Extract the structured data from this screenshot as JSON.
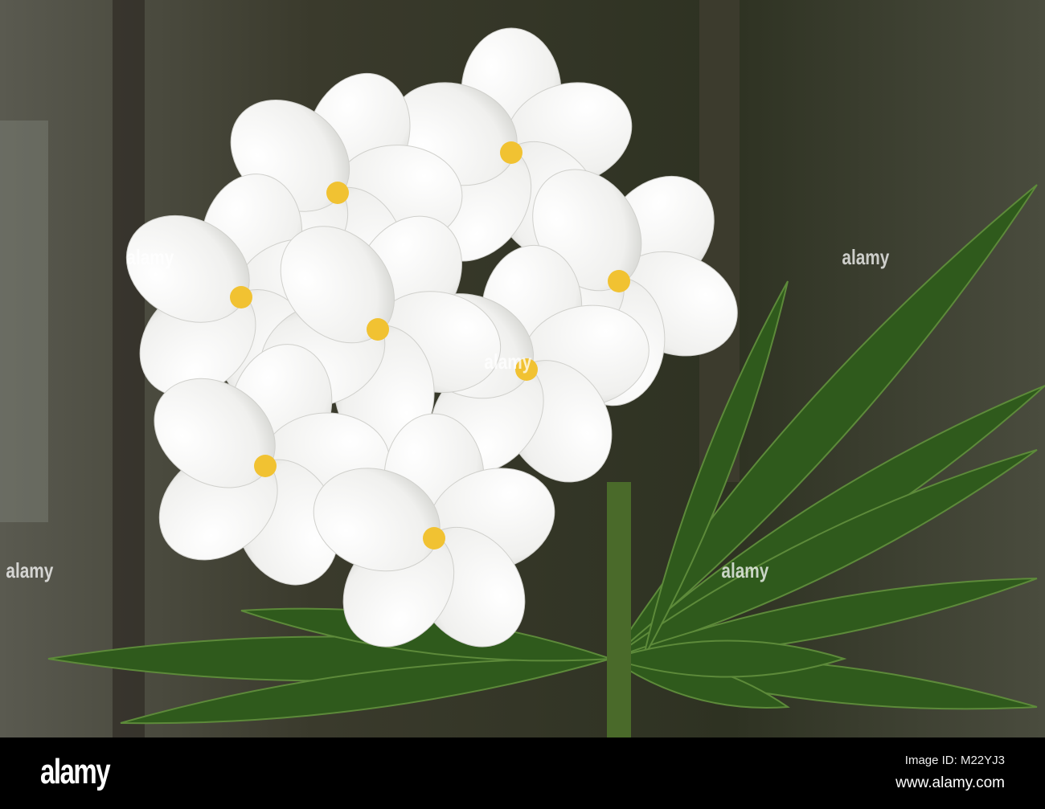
{
  "photo": {
    "subject": "white-flowers-with-green-leaves"
  },
  "watermark": {
    "text": "alamy"
  },
  "footer": {
    "logo": "alamy",
    "image_id": "Image ID: M22YJ3",
    "website": "www.alamy.com"
  }
}
